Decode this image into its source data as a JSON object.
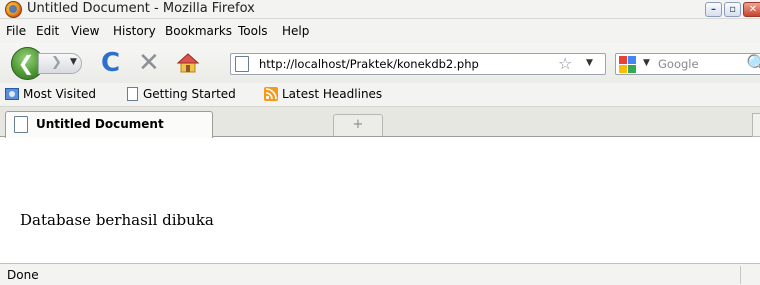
{
  "window": {
    "title": "Untitled Document - Mozilla Firefox",
    "controls": {
      "minimize": "–",
      "maximize": "▫",
      "close": "✕"
    }
  },
  "menu": [
    "File",
    "Edit",
    "View",
    "History",
    "Bookmarks",
    "Tools",
    "Help"
  ],
  "nav": {
    "url": "http://localhost/Praktek/konekdb2.php",
    "search_placeholder": "Google",
    "icons": [
      "back-icon",
      "forward-icon",
      "reload-icon",
      "stop-icon",
      "home-icon",
      "page-icon",
      "star-icon",
      "search-engine-icon",
      "magnifier-icon"
    ]
  },
  "bookmarks": [
    {
      "label": "Most Visited",
      "icon": "most-visited-icon"
    },
    {
      "label": "Getting Started",
      "icon": "page-icon"
    },
    {
      "label": "Latest Headlines",
      "icon": "rss-icon"
    }
  ],
  "tabs": [
    {
      "label": "Untitled Document",
      "active": true
    }
  ],
  "content": {
    "text": "Database berhasil dibuka"
  },
  "status": {
    "text": "Done"
  },
  "colors": {
    "chrome": "#f3f3f1",
    "reload": "#2d6fcf",
    "back": "#4f9b35"
  }
}
